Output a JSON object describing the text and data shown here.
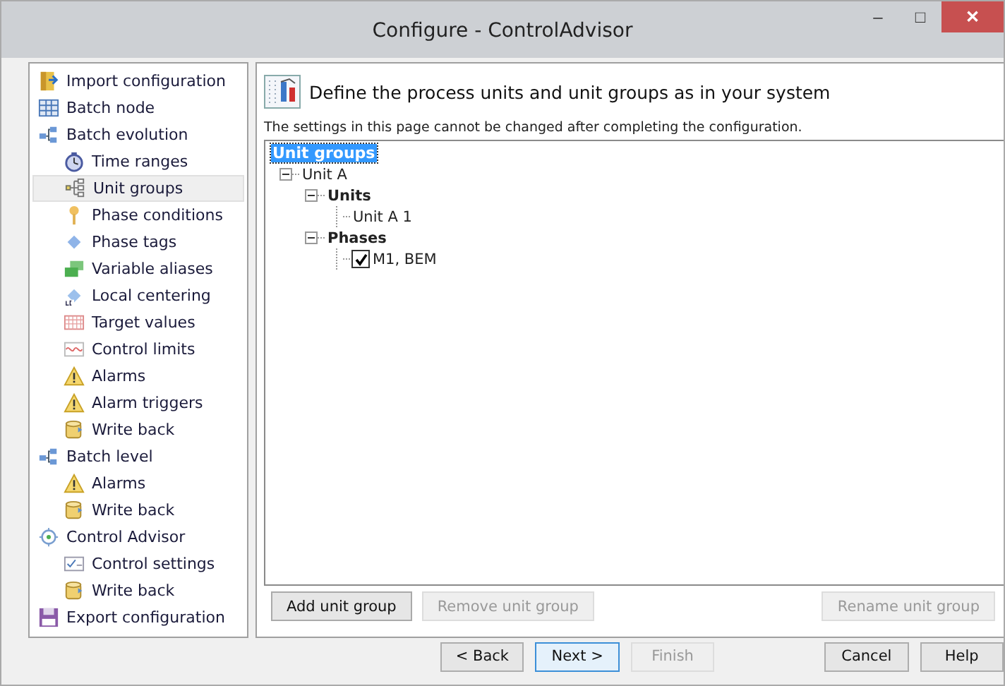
{
  "window": {
    "title": "Configure - ControlAdvisor",
    "controls": [
      "–",
      "□",
      "✕"
    ]
  },
  "sidebar": {
    "items": [
      {
        "label": "Import configuration",
        "selected": false
      },
      {
        "label": "Batch node",
        "selected": false
      },
      {
        "label": "Batch evolution",
        "selected": false,
        "children": [
          {
            "label": "Time ranges",
            "selected": false
          },
          {
            "label": "Unit groups",
            "selected": true
          },
          {
            "label": "Phase conditions",
            "selected": false
          },
          {
            "label": "Phase tags",
            "selected": false
          },
          {
            "label": "Variable aliases",
            "selected": false
          },
          {
            "label": "Local centering",
            "selected": false
          },
          {
            "label": "Target values",
            "selected": false
          },
          {
            "label": "Control limits",
            "selected": false
          },
          {
            "label": "Alarms",
            "selected": false
          },
          {
            "label": "Alarm triggers",
            "selected": false
          },
          {
            "label": "Write back",
            "selected": false
          }
        ]
      },
      {
        "label": "Batch level",
        "selected": false,
        "children": [
          {
            "label": "Alarms",
            "selected": false
          },
          {
            "label": "Write back",
            "selected": false
          }
        ]
      },
      {
        "label": "Control Advisor",
        "selected": false,
        "children": [
          {
            "label": "Control settings",
            "selected": false
          },
          {
            "label": "Write back",
            "selected": false
          }
        ]
      },
      {
        "label": "Export configuration",
        "selected": false
      }
    ]
  },
  "page": {
    "heading": "Define the process units and unit groups as in your system",
    "note": "The settings in this page cannot be changed after completing the configuration."
  },
  "tree": {
    "label": "Unit groups",
    "selected": true,
    "children": [
      {
        "label": "Unit A",
        "expanded": true,
        "children": [
          {
            "label": "Units",
            "kind": "category",
            "expanded": true,
            "children": [
              {
                "label": "Unit A 1"
              }
            ]
          },
          {
            "label": "Phases",
            "kind": "category",
            "expanded": true,
            "children": [
              {
                "label": "M1, BEM",
                "kind": "check",
                "checked": true
              }
            ]
          }
        ]
      }
    ]
  },
  "tree_buttons": [
    {
      "label": "Add unit group",
      "disabled": false
    },
    {
      "label": "Remove unit group",
      "disabled": true
    },
    {
      "label": "Rename unit group",
      "disabled": true
    }
  ],
  "footer_buttons": [
    {
      "label": "< Back",
      "disabled": false,
      "default": false
    },
    {
      "label": "Next >",
      "disabled": false,
      "default": true
    },
    {
      "label": "Finish",
      "disabled": true,
      "default": false
    },
    {
      "label": "Cancel",
      "disabled": false,
      "default": false
    },
    {
      "label": "Help",
      "disabled": false,
      "default": false
    }
  ]
}
